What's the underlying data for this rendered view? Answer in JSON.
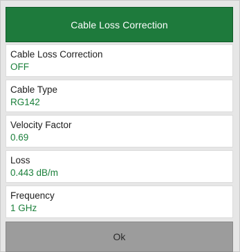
{
  "dialog": {
    "title": "Cable Loss Correction",
    "items": [
      {
        "label": "Cable Loss Correction",
        "value": "OFF"
      },
      {
        "label": "Cable Type",
        "value": "RG142"
      },
      {
        "label": "Velocity Factor",
        "value": "0.69"
      },
      {
        "label": "Loss",
        "value": "0.443 dB/m"
      },
      {
        "label": "Frequency",
        "value": "1 GHz"
      }
    ],
    "ok_label": "Ok"
  },
  "colors": {
    "header_bg": "#1e7a3c",
    "value_text": "#1a7f3a",
    "button_bg": "#9c9c9c"
  }
}
